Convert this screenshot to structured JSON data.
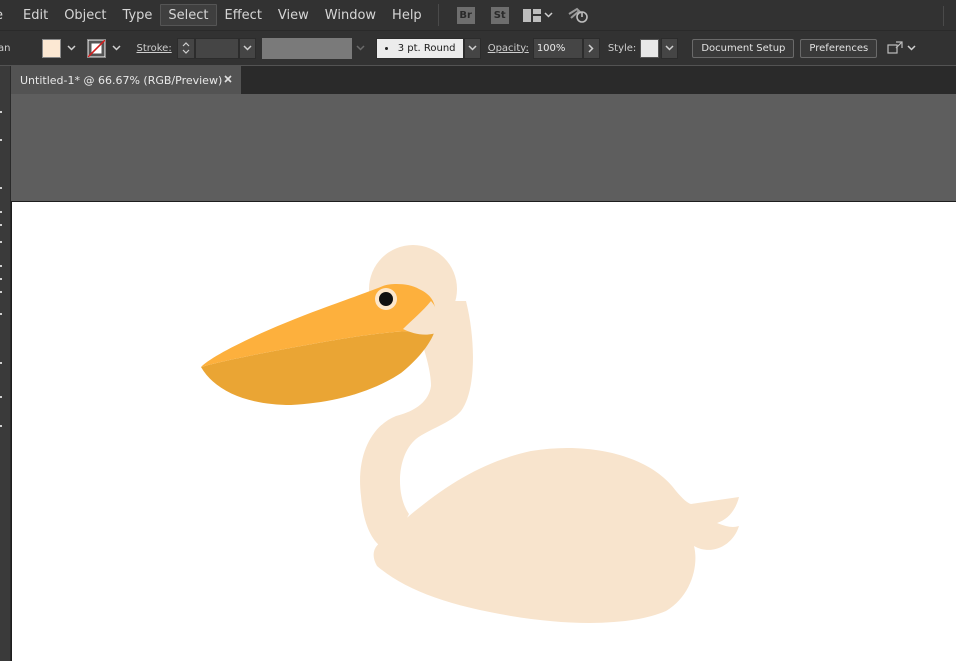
{
  "menubar": {
    "items": [
      "e",
      "Edit",
      "Object",
      "Type",
      "Select",
      "Effect",
      "View",
      "Window",
      "Help"
    ],
    "active": "Select",
    "bridge_badge": "Br",
    "stock_badge": "St",
    "icons": [
      "arrange-documents-icon",
      "chevron-down-icon",
      "gpu-performance-icon"
    ]
  },
  "controlbar": {
    "left_label": "an",
    "fill_color": "#fce8d3",
    "stroke_label": "Stroke:",
    "brush_label": "3 pt. Round",
    "opacity_label": "Opacity:",
    "opacity_value": "100%",
    "style_label": "Style:",
    "document_setup": "Document Setup",
    "preferences": "Preferences"
  },
  "tab": {
    "title": "Untitled-1* @ 66.67% (RGB/Preview)",
    "close": "×"
  },
  "colors": {
    "pelican_body": "#f8e4cd",
    "beak_top": "#fdb03d",
    "beak_bottom": "#eaa534",
    "eye_ring": "#fde7cb",
    "eye_pupil": "#111111",
    "ui_dark": "#323232",
    "canvas_bg": "#5e5e5e",
    "artboard": "#ffffff"
  }
}
